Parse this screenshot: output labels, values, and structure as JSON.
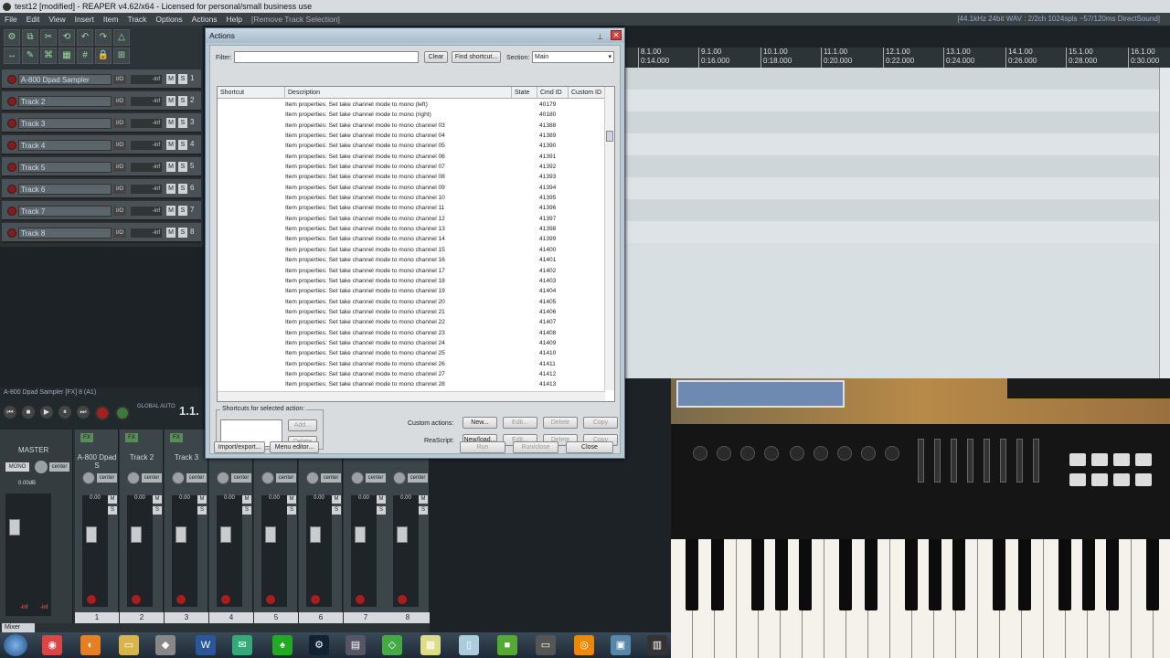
{
  "window": {
    "title": "test12 [modified] - REAPER v4.62/x64 - Licensed for personal/small business use"
  },
  "status_right": "[44.1kHz 24bit WAV : 2/2ch 1024spls ~57/120ms DirectSound]",
  "menu": [
    "File",
    "Edit",
    "View",
    "Insert",
    "Item",
    "Track",
    "Options",
    "Actions",
    "Help",
    "[Remove Track Selection]"
  ],
  "tracks": [
    {
      "name": "A-800 Dpad Sampler",
      "num": "1"
    },
    {
      "name": "Track 2",
      "num": "2"
    },
    {
      "name": "Track 3",
      "num": "3"
    },
    {
      "name": "Track 4",
      "num": "4"
    },
    {
      "name": "Track 5",
      "num": "5"
    },
    {
      "name": "Track 6",
      "num": "6"
    },
    {
      "name": "Track 7",
      "num": "7"
    },
    {
      "name": "Track 8",
      "num": "8"
    }
  ],
  "track_controls": {
    "io": "I/O",
    "vol": "-inf",
    "mute": "M",
    "solo": "S"
  },
  "ruler": [
    {
      "bar": "8.1.00",
      "time": "0:14.000"
    },
    {
      "bar": "9.1.00",
      "time": "0:16.000"
    },
    {
      "bar": "10.1.00",
      "time": "0:18.000"
    },
    {
      "bar": "11.1.00",
      "time": "0:20.000"
    },
    {
      "bar": "12.1.00",
      "time": "0:22.000"
    },
    {
      "bar": "13.1.00",
      "time": "0:24.000"
    },
    {
      "bar": "14.1.00",
      "time": "0:26.000"
    },
    {
      "bar": "15.1.00",
      "time": "0:28.000"
    },
    {
      "bar": "16.1.00",
      "time": "0:30.000"
    }
  ],
  "transport": {
    "fx_label": "A-800 Dpad Sampler [FX] 8 (A1)",
    "global": "GLOBAL AUTO",
    "position": "1.1."
  },
  "mixer": {
    "master": {
      "label": "MASTER",
      "mono": "MONO",
      "db": "0.00dB",
      "left": "-inf",
      "right": "-inf"
    },
    "strips": [
      {
        "name": "A-800 Dpad S",
        "idx": "1"
      },
      {
        "name": "Track 2",
        "idx": "2"
      },
      {
        "name": "Track 3",
        "idx": "3"
      },
      {
        "name": "",
        "idx": "4"
      },
      {
        "name": "",
        "idx": "5"
      },
      {
        "name": "",
        "idx": "6"
      },
      {
        "name": "",
        "idx": "7"
      },
      {
        "name": "",
        "idx": "8"
      }
    ],
    "pan": "center",
    "fader_db": "0.00",
    "tab": "Mixer"
  },
  "actions_dialog": {
    "title": "Actions",
    "filter_label": "Filter:",
    "filter_value": "",
    "clear": "Clear",
    "find_shortcut": "Find shortcut...",
    "section_label": "Section:",
    "section_value": "Main",
    "columns": [
      "Shortcut",
      "Description",
      "State",
      "Cmd ID",
      "Custom ID"
    ],
    "rows": [
      {
        "desc": "Item properties: Set take channel mode to mono (left)",
        "cmd": "40179"
      },
      {
        "desc": "Item properties: Set take channel mode to mono (right)",
        "cmd": "40180"
      },
      {
        "desc": "Item properties: Set take channel mode to mono channel 03",
        "cmd": "41388"
      },
      {
        "desc": "Item properties: Set take channel mode to mono channel 04",
        "cmd": "41389"
      },
      {
        "desc": "Item properties: Set take channel mode to mono channel 05",
        "cmd": "41390"
      },
      {
        "desc": "Item properties: Set take channel mode to mono channel 06",
        "cmd": "41391"
      },
      {
        "desc": "Item properties: Set take channel mode to mono channel 07",
        "cmd": "41392"
      },
      {
        "desc": "Item properties: Set take channel mode to mono channel 08",
        "cmd": "41393"
      },
      {
        "desc": "Item properties: Set take channel mode to mono channel 09",
        "cmd": "41394"
      },
      {
        "desc": "Item properties: Set take channel mode to mono channel 10",
        "cmd": "41395"
      },
      {
        "desc": "Item properties: Set take channel mode to mono channel 11",
        "cmd": "41396"
      },
      {
        "desc": "Item properties: Set take channel mode to mono channel 12",
        "cmd": "41397"
      },
      {
        "desc": "Item properties: Set take channel mode to mono channel 13",
        "cmd": "41398"
      },
      {
        "desc": "Item properties: Set take channel mode to mono channel 14",
        "cmd": "41399"
      },
      {
        "desc": "Item properties: Set take channel mode to mono channel 15",
        "cmd": "41400"
      },
      {
        "desc": "Item properties: Set take channel mode to mono channel 16",
        "cmd": "41401"
      },
      {
        "desc": "Item properties: Set take channel mode to mono channel 17",
        "cmd": "41402"
      },
      {
        "desc": "Item properties: Set take channel mode to mono channel 18",
        "cmd": "41403"
      },
      {
        "desc": "Item properties: Set take channel mode to mono channel 19",
        "cmd": "41404"
      },
      {
        "desc": "Item properties: Set take channel mode to mono channel 20",
        "cmd": "41405"
      },
      {
        "desc": "Item properties: Set take channel mode to mono channel 21",
        "cmd": "41406"
      },
      {
        "desc": "Item properties: Set take channel mode to mono channel 22",
        "cmd": "41407"
      },
      {
        "desc": "Item properties: Set take channel mode to mono channel 23",
        "cmd": "41408"
      },
      {
        "desc": "Item properties: Set take channel mode to mono channel 24",
        "cmd": "41409"
      },
      {
        "desc": "Item properties: Set take channel mode to mono channel 25",
        "cmd": "41410"
      },
      {
        "desc": "Item properties: Set take channel mode to mono channel 26",
        "cmd": "41411"
      },
      {
        "desc": "Item properties: Set take channel mode to mono channel 27",
        "cmd": "41412"
      },
      {
        "desc": "Item properties: Set take channel mode to mono channel 28",
        "cmd": "41413"
      }
    ],
    "shortcuts_group": "Shortcuts for selected action:",
    "add": "Add...",
    "delete": "Delete",
    "custom_actions_label": "Custom actions:",
    "reascript_label": "ReaScript:",
    "new": "New...",
    "new_load": "New/load...",
    "edit": "Edit...",
    "copy": "Copy",
    "import_export": "Import/export...",
    "menu_editor": "Menu editor...",
    "run": "Run",
    "run_close": "Run/close",
    "close": "Close"
  },
  "colors": {
    "accent": "#b7c8d6",
    "record": "#a81e1e",
    "arrange_bg": "#d8dfe3"
  }
}
